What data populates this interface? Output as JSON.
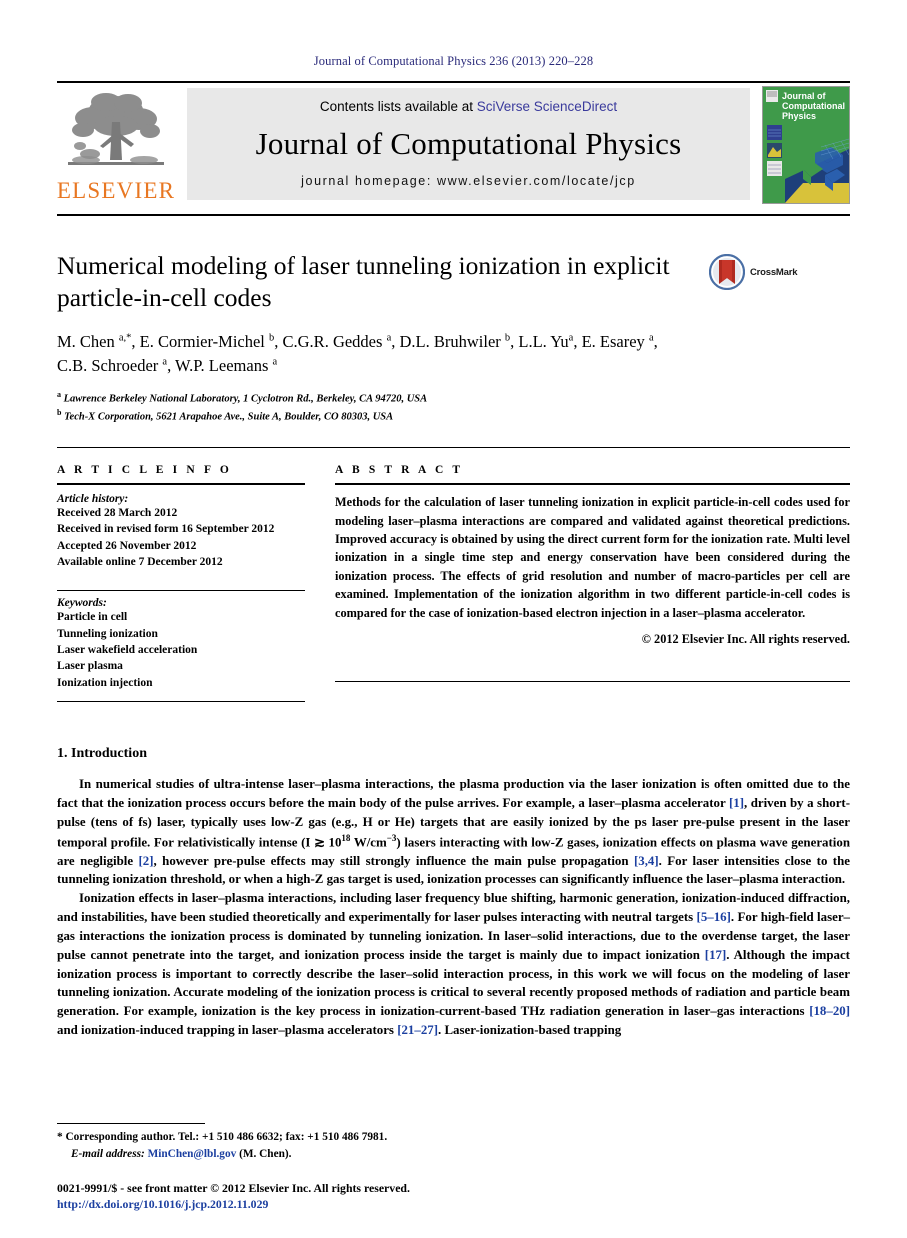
{
  "running_head": "Journal of Computational Physics 236 (2013) 220–228",
  "masthead": {
    "publisher_name": "ELSEVIER",
    "contents_prefix": "Contents lists available at ",
    "contents_link": "SciVerse ScienceDirect",
    "journal_title": "Journal of Computational Physics",
    "homepage_line": "journal homepage: www.elsevier.com/locate/jcp",
    "cover_line1": "Journal of",
    "cover_line2": "Computational",
    "cover_line3": "Physics"
  },
  "article": {
    "title": "Numerical modeling of laser tunneling ionization in explicit particle-in-cell codes",
    "crossmark_label": "CrossMark",
    "authors_line1": "M. Chen a,*, E. Cormier-Michel b, C.G.R. Geddes a, D.L. Bruhwiler b, L.L. Yu a, E. Esarey a,",
    "authors_line2": "C.B. Schroeder a, W.P. Leemans a",
    "affiliation_a": "Lawrence Berkeley National Laboratory, 1 Cyclotron Rd., Berkeley, CA 94720, USA",
    "affiliation_b": "Tech-X Corporation, 5621 Arapahoe Ave., Suite A, Boulder, CO 80303, USA"
  },
  "article_info": {
    "heading": "A R T I C L E   I N F O",
    "history_heading": "Article history:",
    "history": [
      "Received 28 March 2012",
      "Received in revised form 16 September 2012",
      "Accepted 26 November 2012",
      "Available online 7 December 2012"
    ],
    "keywords_heading": "Keywords:",
    "keywords": [
      "Particle in cell",
      "Tunneling ionization",
      "Laser wakefield acceleration",
      "Laser plasma",
      "Ionization injection"
    ]
  },
  "abstract": {
    "heading": "A B S T R A C T",
    "body": "Methods for the calculation of laser tunneling ionization in explicit particle-in-cell codes used for modeling laser–plasma interactions are compared and validated against theoretical predictions. Improved accuracy is obtained by using the direct current form for the ionization rate. Multi level ionization in a single time step and energy conservation have been considered during the ionization process. The effects of grid resolution and number of macro-particles per cell are examined. Implementation of the ionization algorithm in two different particle-in-cell codes is compared for the case of ionization-based electron injection in a laser–plasma accelerator.",
    "copyright": "© 2012 Elsevier Inc. All rights reserved."
  },
  "introduction": {
    "heading": "1. Introduction",
    "paragraph1_pre": "In numerical studies of ultra-intense laser–plasma interactions, the plasma production via the laser ionization is often omitted due to the fact that the ionization process occurs before the main body of the pulse arrives. For example, a laser–plasma accelerator ",
    "ref1": "[1]",
    "paragraph1_mid": ", driven by a short-pulse (tens of fs) laser, typically uses low-Z gas (e.g., H or He) targets that are easily ionized by the ps laser pre-pulse present in the laser temporal profile. For relativistically intense (I ≳ 10",
    "exp18": "18",
    "paragraph1_mid2": " W/cm",
    "expm3": "−3",
    "paragraph1_mid3": ") lasers interacting with low-Z gases, ionization effects on plasma wave generation are negligible ",
    "ref2": "[2]",
    "paragraph1_mid4": ", however pre-pulse effects may still strongly influence the main pulse propagation ",
    "ref34": "[3,4]",
    "paragraph1_end": ". For laser intensities close to the tunneling ionization threshold, or when a high-Z gas target is used, ionization processes can significantly influence the laser–plasma interaction.",
    "paragraph2_pre": "Ionization effects in laser–plasma interactions, including laser frequency blue shifting, harmonic generation, ionization-induced diffraction, and instabilities, have been studied theoretically and experimentally for laser pulses interacting with neutral targets ",
    "ref516": "[5–16]",
    "paragraph2_mid": ". For high-field laser–gas interactions the ionization process is dominated by tunneling ionization. In laser–solid interactions, due to the overdense target, the laser pulse cannot penetrate into the target, and ionization process inside the target is mainly due to impact ionization ",
    "ref17": "[17]",
    "paragraph2_mid2": ". Although the impact ionization process is important to correctly describe the laser–solid interaction process, in this work we will focus on the modeling of laser tunneling ionization. Accurate modeling of the ionization process is critical to several recently proposed methods of radiation and particle beam generation. For example, ionization is the key process in ionization-current-based THz radiation generation in laser–gas interactions ",
    "ref1820": "[18–20]",
    "paragraph2_mid3": " and ionization-induced trapping in laser–plasma accelerators ",
    "ref2127": "[21–27]",
    "paragraph2_end": ". Laser-ionization-based trapping"
  },
  "footer": {
    "corresponding": "* Corresponding author. Tel.: +1 510 486 6632; fax: +1 510 486 7981.",
    "email_label": "E-mail address:",
    "email": "MinChen@lbl.gov",
    "email_suffix": " (M. Chen).",
    "imprint": "0021-9991/$ - see front matter © 2012 Elsevier Inc. All rights reserved.",
    "doi": "http://dx.doi.org/10.1016/j.jcp.2012.11.029"
  },
  "colors": {
    "running_head": "#2a2a7a",
    "elsevier_orange": "#E87722",
    "link_blue": "#3a3a9c",
    "reference_blue": "#1b3fa0",
    "masthead_bg": "#e8e8e8",
    "cover_green": "#3f9a4a"
  }
}
